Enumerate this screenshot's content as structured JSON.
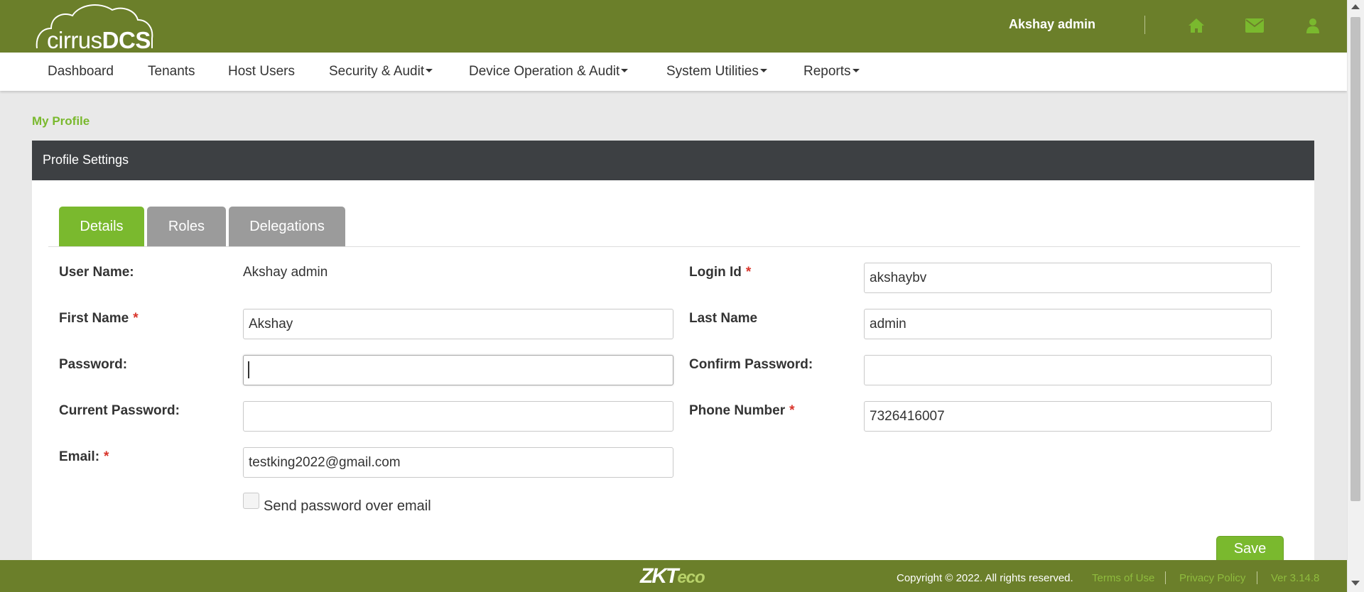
{
  "brand": {
    "logo_text_light": "cirrus",
    "logo_text_bold": "DCS"
  },
  "header": {
    "user_name": "Akshay admin",
    "icons": [
      "home-icon",
      "mail-icon",
      "user-icon"
    ]
  },
  "nav": {
    "items": [
      {
        "label": "Dashboard",
        "dropdown": false
      },
      {
        "label": "Tenants",
        "dropdown": false
      },
      {
        "label": "Host Users",
        "dropdown": false
      },
      {
        "label": "Security & Audit",
        "dropdown": true
      },
      {
        "label": "Device Operation & Audit",
        "dropdown": true
      },
      {
        "label": "System Utilities",
        "dropdown": true
      },
      {
        "label": "Reports",
        "dropdown": true
      }
    ]
  },
  "breadcrumb": "My Profile",
  "panel": {
    "title": "Profile Settings"
  },
  "tabs": [
    {
      "label": "Details",
      "active": true
    },
    {
      "label": "Roles",
      "active": false
    },
    {
      "label": "Delegations",
      "active": false
    }
  ],
  "form": {
    "user_name": {
      "label": "User Name:",
      "value": "Akshay admin"
    },
    "login_id": {
      "label": "Login Id",
      "value": "akshaybv",
      "required": true
    },
    "first_name": {
      "label": "First Name",
      "value": "Akshay",
      "required": true
    },
    "last_name": {
      "label": "Last Name",
      "value": "admin"
    },
    "password": {
      "label": "Password:",
      "value": ""
    },
    "confirm_password": {
      "label": "Confirm Password:",
      "value": ""
    },
    "current_password": {
      "label": "Current Password:",
      "value": ""
    },
    "phone_number": {
      "label": "Phone Number",
      "value": "7326416007",
      "required": true
    },
    "email": {
      "label": "Email:",
      "value": "testking2022@gmail.com",
      "required": true
    },
    "send_password_checkbox": {
      "label": "Send password over email",
      "checked": false
    },
    "required_marker": "*",
    "save_label": "Save"
  },
  "footer": {
    "logo_zk": "ZKT",
    "logo_eco": "eco",
    "copyright": "Copyright © 2022. All rights reserved.",
    "terms": "Terms of Use",
    "privacy": "Privacy Policy",
    "version": "Ver 3.14.8"
  },
  "colors": {
    "header_bg": "#6b7f2a",
    "accent_green": "#7ab92e",
    "panel_header_bg": "#3d4043",
    "tab_inactive": "#9b9b9b",
    "required_red": "#d9352b",
    "page_bg": "#e9e9e9"
  }
}
